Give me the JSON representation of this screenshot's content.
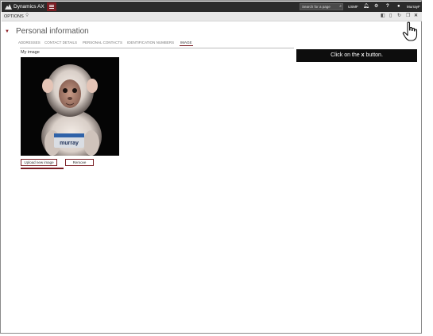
{
  "navbar": {
    "app_title": "Dynamics AX",
    "search_placeholder": "Search for a page",
    "company": "USMF",
    "user_name": "MurrayF",
    "icons": [
      "bell-icon",
      "gear-icon",
      "help-icon",
      "user-avatar-icon"
    ]
  },
  "options_bar": {
    "options_label": "OPTIONS",
    "icons": [
      "office-icon",
      "attach-icon",
      "refresh-icon",
      "new-window-icon",
      "close-icon"
    ]
  },
  "section": {
    "title": "Personal information"
  },
  "tabs": [
    {
      "label": "ADDRESSES",
      "active": false
    },
    {
      "label": "CONTACT DETAILS",
      "active": false
    },
    {
      "label": "PERSONAL CONTACTS",
      "active": false
    },
    {
      "label": "IDENTIFICATION NUMBERS",
      "active": false
    },
    {
      "label": "IMAGE",
      "active": true
    }
  ],
  "image_panel": {
    "label": "My image",
    "badge_text": "murray",
    "upload_label": "Upload new image",
    "remove_label": "Remove"
  },
  "tooltip": {
    "prefix": "Click on the ",
    "key": "x",
    "suffix": " button."
  },
  "colors": {
    "accent": "#7a1e24",
    "navbar": "#2b2b2b",
    "options_bar": "#e8e8e8"
  }
}
